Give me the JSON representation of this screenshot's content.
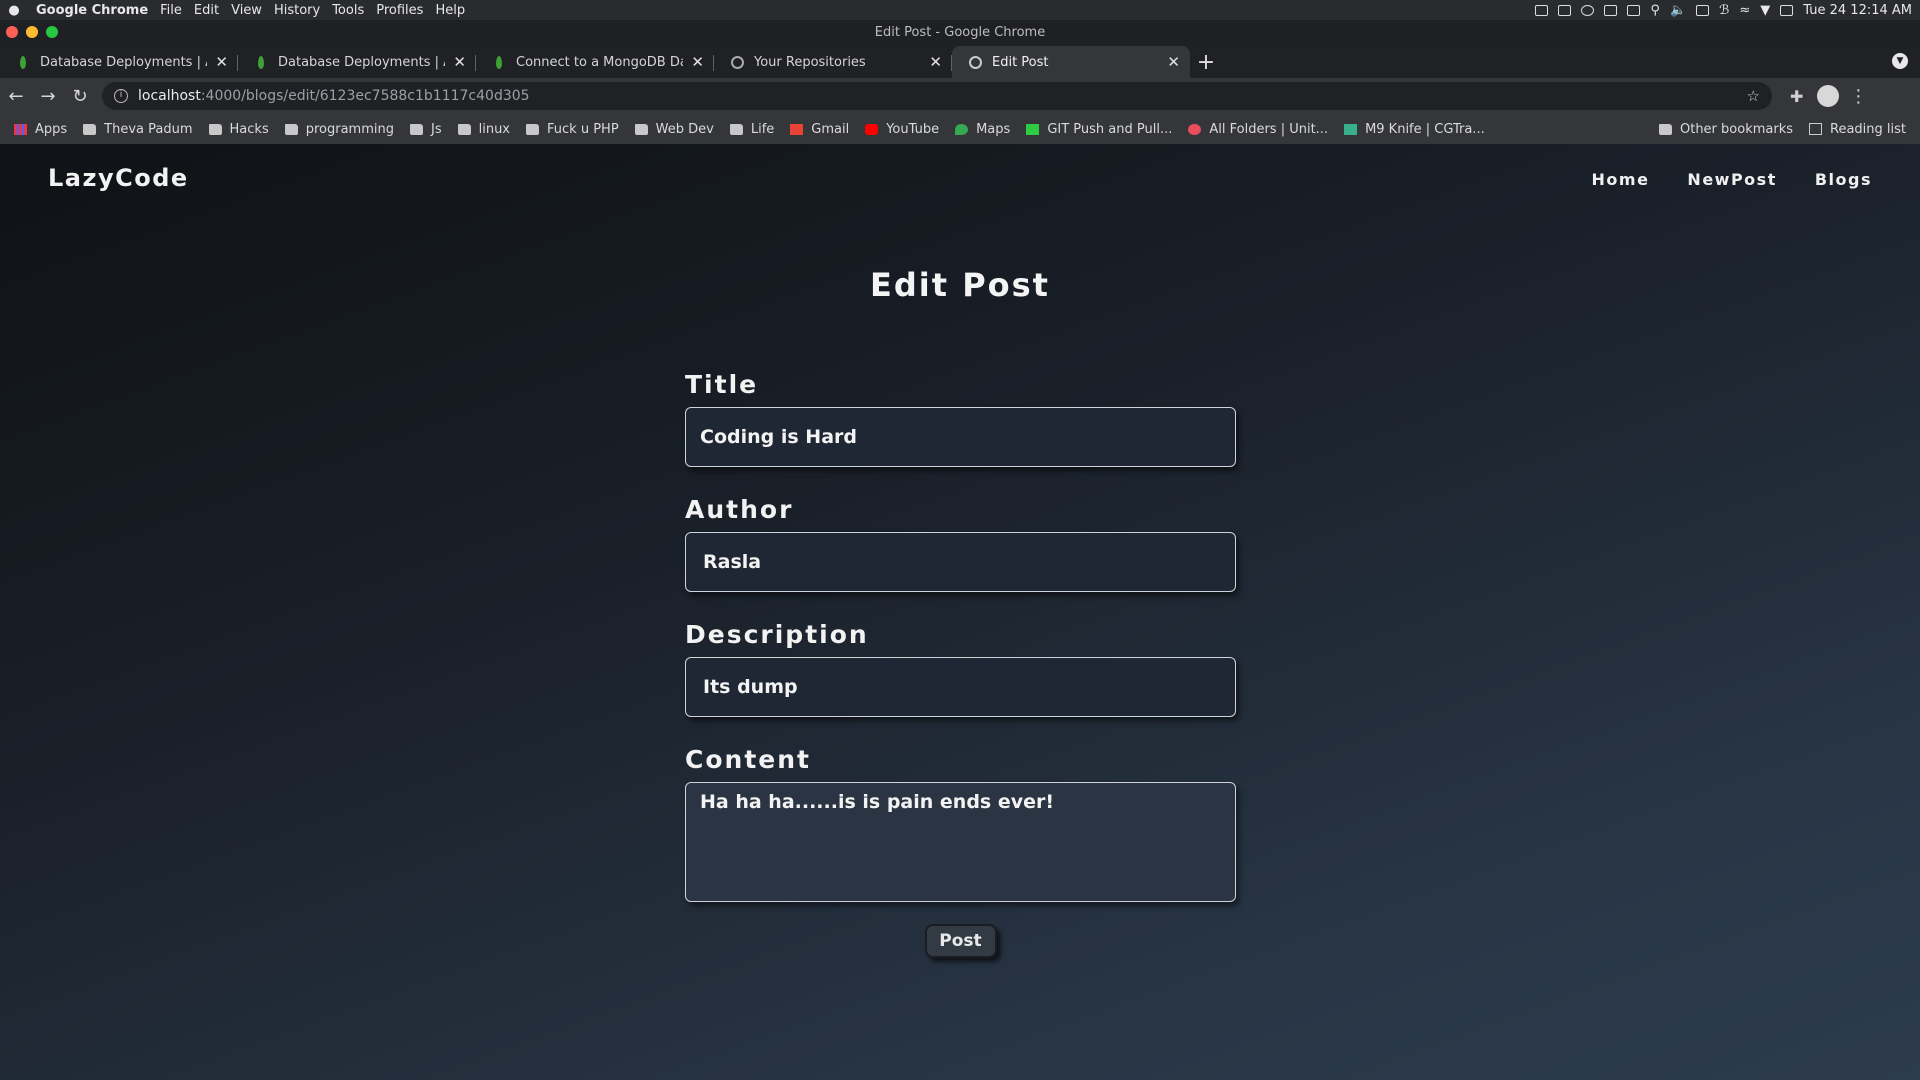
{
  "menubar": {
    "app_name": "Google Chrome",
    "items": [
      "File",
      "Edit",
      "View",
      "History",
      "Tools",
      "Profiles",
      "Help"
    ],
    "clock": "Tue 24  12:14 AM"
  },
  "window": {
    "title": "Edit Post - Google Chrome"
  },
  "tabs": [
    {
      "label": "Database Deployments | Atla",
      "icon": "mongodb-leaf-icon"
    },
    {
      "label": "Database Deployments | Atla",
      "icon": "mongodb-leaf-icon"
    },
    {
      "label": "Connect to a MongoDB Datal",
      "icon": "mongodb-leaf-icon"
    },
    {
      "label": "Your Repositories",
      "icon": "github-icon"
    },
    {
      "label": "Edit Post",
      "icon": "globe-icon"
    }
  ],
  "address": {
    "host": "localhost",
    "path": ":4000/blogs/edit/6123ec7588c1b1117c40d305"
  },
  "bookmarks": [
    {
      "label": "Apps",
      "icon": "apps-grid"
    },
    {
      "label": "Theva Padum",
      "icon": "folder"
    },
    {
      "label": "Hacks",
      "icon": "folder"
    },
    {
      "label": "programming",
      "icon": "folder"
    },
    {
      "label": "Js",
      "icon": "folder"
    },
    {
      "label": "linux",
      "icon": "folder"
    },
    {
      "label": "Fuck u PHP",
      "icon": "folder"
    },
    {
      "label": "Web Dev",
      "icon": "folder"
    },
    {
      "label": "Life",
      "icon": "folder"
    },
    {
      "label": "Gmail",
      "icon": "gmail"
    },
    {
      "label": "YouTube",
      "icon": "yt"
    },
    {
      "label": "Maps",
      "icon": "maps"
    },
    {
      "label": "GIT Push and Pull...",
      "icon": "gitb"
    },
    {
      "label": "All Folders | Unit...",
      "icon": "uni"
    },
    {
      "label": "M9 Knife | CGTra...",
      "icon": "cg"
    }
  ],
  "bookmarks_right": {
    "other": "Other bookmarks",
    "reading": "Reading list"
  },
  "site": {
    "brand": "LazyCode",
    "nav": {
      "home": "Home",
      "newpost": "NewPost",
      "blogs": "Blogs"
    }
  },
  "form": {
    "heading": "Edit Post",
    "title_label": "Title",
    "title_value": "Coding is Hard",
    "author_label": "Author",
    "author_value": "Rasla",
    "description_label": "Description",
    "description_value": "Its dump",
    "content_label": "Content",
    "content_value": "Ha ha ha......is is pain ends ever!",
    "submit_label": "Post"
  }
}
